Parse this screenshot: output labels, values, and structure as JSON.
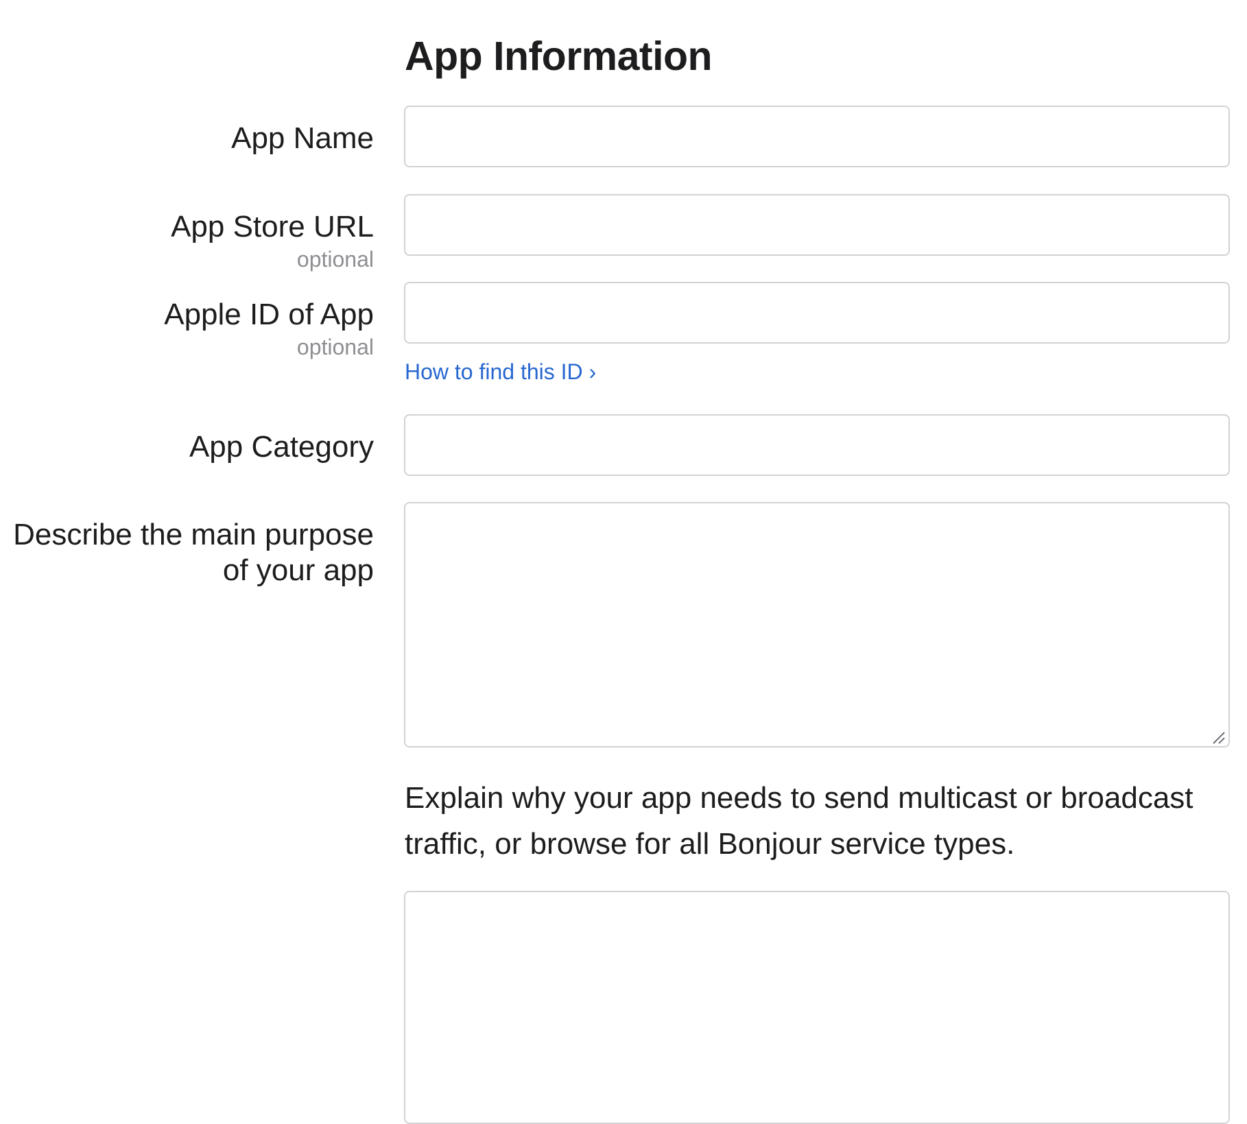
{
  "section": {
    "title": "App Information"
  },
  "fields": {
    "app_name": {
      "label": "App Name",
      "value": ""
    },
    "app_store_url": {
      "label": "App Store URL",
      "hint": "optional",
      "value": ""
    },
    "apple_id": {
      "label": "Apple ID of App",
      "hint": "optional",
      "value": "",
      "help_link": "How to find this ID ›"
    },
    "app_category": {
      "label": "App Category",
      "value": ""
    },
    "main_purpose": {
      "label_line1": "Describe the main purpose",
      "label_line2": "of your app",
      "value": ""
    },
    "multicast_reason": {
      "prompt": "Explain why your app needs to send multicast or broadcast traffic, or browse for all Bonjour service types.",
      "value": ""
    }
  },
  "colors": {
    "text": "#1d1d1f",
    "secondary_text": "#8e8e93",
    "link": "#2867d0",
    "field_border": "#d2d2d7",
    "background": "#ffffff"
  }
}
